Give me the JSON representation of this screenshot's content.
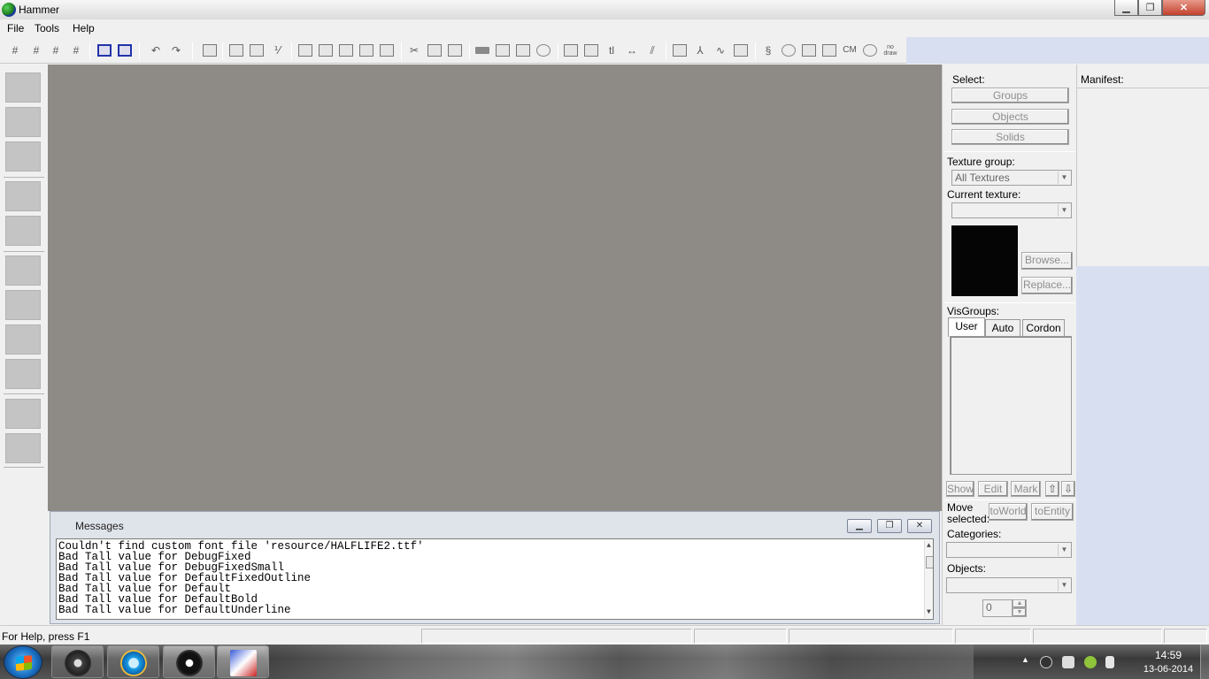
{
  "window": {
    "title": "Hammer",
    "min": "▁",
    "max": "❐",
    "close": "✕"
  },
  "menu": [
    "File",
    "Tools",
    "Help"
  ],
  "toolbar": {
    "cordon_label": "CM",
    "nodraw_label_1": "no",
    "nodraw_label_2": "draw"
  },
  "messages": {
    "title": "Messages",
    "lines": [
      "Couldn't find custom font file 'resource/HALFLIFE2.ttf'",
      "Bad Tall value for DebugFixed",
      "Bad Tall value for DebugFixedSmall",
      "Bad Tall value for DefaultFixedOutline",
      "Bad Tall value for Default",
      "Bad Tall value for DefaultBold",
      "Bad Tall value for DefaultUnderline"
    ]
  },
  "right_panel": {
    "select_label": "Select:",
    "groups": "Groups",
    "objects_btn": "Objects",
    "solids": "Solids",
    "texture_group_label": "Texture group:",
    "texture_group_value": "All Textures",
    "current_texture_label": "Current texture:",
    "current_texture_value": "",
    "browse": "Browse...",
    "replace": "Replace...",
    "visgroups_label": "VisGroups:",
    "tabs": [
      "User",
      "Auto",
      "Cordon"
    ],
    "show": "Show",
    "edit": "Edit",
    "mark": "Mark",
    "up": "⇧",
    "down": "⇩",
    "move_label_1": "Move",
    "move_label_2": "selected:",
    "to_world": "toWorld",
    "to_entity": "toEntity",
    "categories_label": "Categories:",
    "objects_label": "Objects:",
    "spinner_value": "0"
  },
  "manifest": {
    "label": "Manifest:"
  },
  "statusbar": {
    "help": "For Help, press F1"
  },
  "taskbar": {
    "time": "14:59",
    "date": "13-06-2014"
  }
}
